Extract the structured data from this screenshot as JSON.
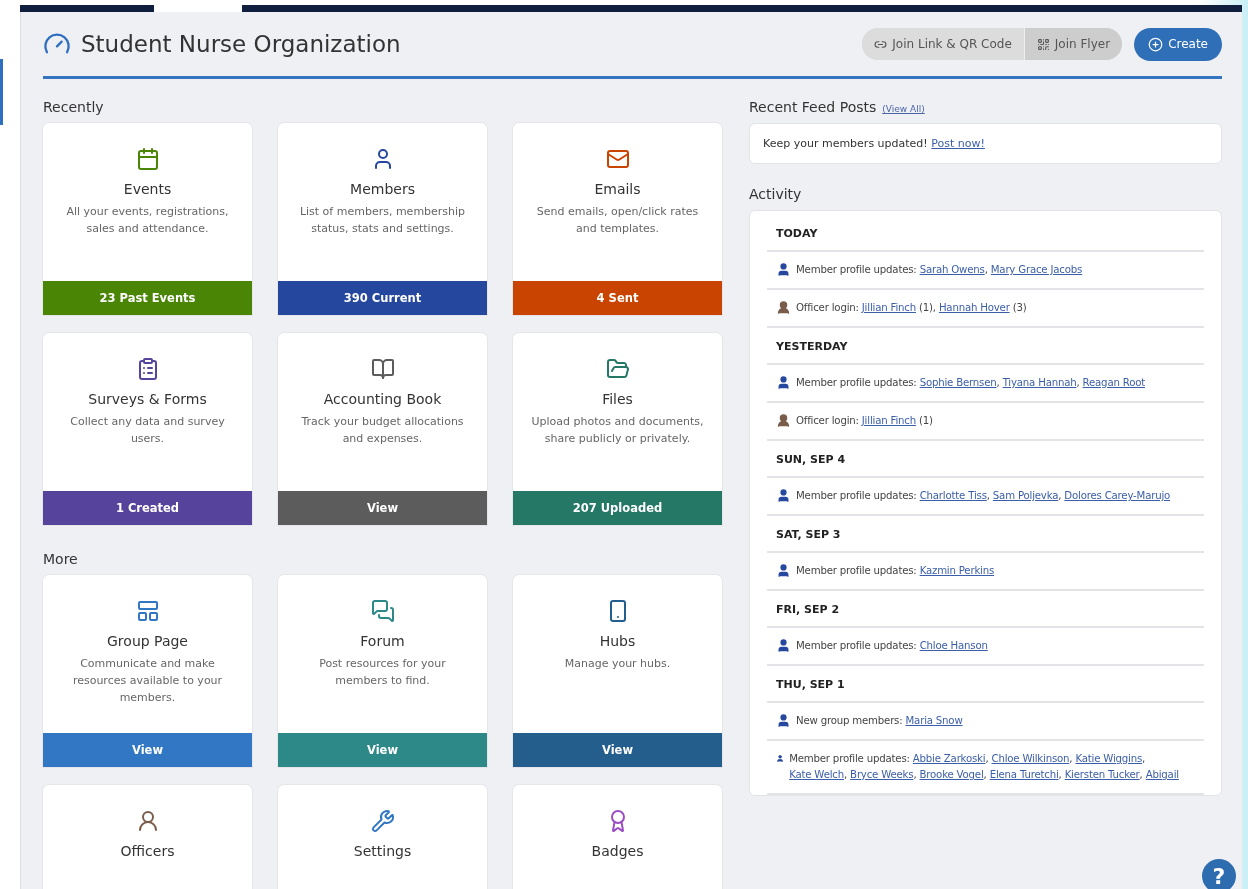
{
  "page": {
    "title": "Student Nurse Organization"
  },
  "header_buttons": [
    {
      "label": "Join Link & QR Code"
    },
    {
      "label": "Join Flyer"
    }
  ],
  "create_button": {
    "label": "Create"
  },
  "sections": [
    {
      "heading": "Recently",
      "cards": [
        {
          "title": "Events",
          "description": "All your events, registrations, sales and attendance.",
          "footer": "23 Past Events",
          "color": "#4a8506"
        },
        {
          "title": "Members",
          "description": "List of members, membership status, stats and settings.",
          "footer": "390 Current",
          "color": "#26479e"
        },
        {
          "title": "Emails",
          "description": "Send emails, open/click rates and templates.",
          "footer": "4 Sent",
          "color": "#c84400"
        },
        {
          "title": "Surveys & Forms",
          "description": "Collect any data and survey users.",
          "footer": "1 Created",
          "color": "#56449c"
        },
        {
          "title": "Accounting Book",
          "description": "Track your budget allocations and expenses.",
          "footer": "View",
          "color": "#5c5c5c"
        },
        {
          "title": "Files",
          "description": "Upload photos and documents, share publicly or privately.",
          "footer": "207 Uploaded",
          "color": "#257866"
        }
      ]
    },
    {
      "heading": "More",
      "cards": [
        {
          "title": "Group Page",
          "description": "Communicate and make resources available to your members.",
          "footer": "View",
          "color": "#3277c3"
        },
        {
          "title": "Forum",
          "description": "Post resources for your members to find.",
          "footer": "View",
          "color": "#2d8888"
        },
        {
          "title": "Hubs",
          "description": "Manage your hubs.",
          "footer": "View",
          "color": "#235e8c"
        },
        {
          "title": "Officers",
          "color": "#7a5c4a"
        },
        {
          "title": "Settings",
          "color": "#3277c3"
        },
        {
          "title": "Badges",
          "color": "#9b4cc4"
        }
      ]
    }
  ],
  "feed": {
    "heading": "Recent Feed Posts",
    "view_all": "(View All)",
    "parts": [
      {
        "kind": "text",
        "text": "Keep your members updated! "
      },
      {
        "kind": "link",
        "text": "Post now!"
      }
    ]
  },
  "activity": {
    "heading": "Activity",
    "days": [
      {
        "label": "TODAY",
        "entries": [
          {
            "kind": "member",
            "parts": [
              {
                "kind": "text",
                "text": "Member profile updates: "
              },
              {
                "kind": "link",
                "text": "Sarah Owens"
              },
              {
                "kind": "text",
                "text": ", "
              },
              {
                "kind": "link",
                "text": "Mary Grace Jacobs"
              }
            ]
          },
          {
            "kind": "officer",
            "parts": [
              {
                "kind": "text",
                "text": "Officer login: "
              },
              {
                "kind": "link",
                "text": "Jillian Finch"
              },
              {
                "kind": "text",
                "text": " (1), "
              },
              {
                "kind": "link",
                "text": "Hannah Hover"
              },
              {
                "kind": "text",
                "text": " (3)"
              }
            ]
          }
        ]
      },
      {
        "label": "YESTERDAY",
        "entries": [
          {
            "kind": "member",
            "parts": [
              {
                "kind": "text",
                "text": "Member profile updates: "
              },
              {
                "kind": "link",
                "text": "Sophie Bernsen"
              },
              {
                "kind": "text",
                "text": ", "
              },
              {
                "kind": "link",
                "text": "Tiyana Hannah"
              },
              {
                "kind": "text",
                "text": ", "
              },
              {
                "kind": "link",
                "text": "Reagan Root"
              }
            ]
          },
          {
            "kind": "officer",
            "parts": [
              {
                "kind": "text",
                "text": "Officer login: "
              },
              {
                "kind": "link",
                "text": "Jillian Finch"
              },
              {
                "kind": "text",
                "text": " (1)"
              }
            ]
          }
        ]
      },
      {
        "label": "SUN, SEP 4",
        "entries": [
          {
            "kind": "member",
            "parts": [
              {
                "kind": "text",
                "text": "Member profile updates: "
              },
              {
                "kind": "link",
                "text": "Charlotte Tiss"
              },
              {
                "kind": "text",
                "text": ", "
              },
              {
                "kind": "link",
                "text": "Sam Poljevka"
              },
              {
                "kind": "text",
                "text": ", "
              },
              {
                "kind": "link",
                "text": "Dolores Carey-Marujo"
              }
            ]
          }
        ]
      },
      {
        "label": "SAT, SEP 3",
        "entries": [
          {
            "kind": "member",
            "parts": [
              {
                "kind": "text",
                "text": "Member profile updates: "
              },
              {
                "kind": "link",
                "text": "Kazmin Perkins"
              }
            ]
          }
        ]
      },
      {
        "label": "FRI, SEP 2",
        "entries": [
          {
            "kind": "member",
            "parts": [
              {
                "kind": "text",
                "text": "Member profile updates: "
              },
              {
                "kind": "link",
                "text": "Chloe Hanson"
              }
            ]
          }
        ]
      },
      {
        "label": "THU, SEP 1",
        "entries": [
          {
            "kind": "member",
            "parts": [
              {
                "kind": "text",
                "text": "New group members: "
              },
              {
                "kind": "link",
                "text": "Maria Snow"
              }
            ]
          },
          {
            "kind": "member",
            "parts": [
              {
                "kind": "text",
                "text": "Member profile updates: "
              },
              {
                "kind": "link",
                "text": "Abbie Zarkoski"
              },
              {
                "kind": "text",
                "text": ", "
              },
              {
                "kind": "link",
                "text": "Chloe Wilkinson"
              },
              {
                "kind": "text",
                "text": ", "
              },
              {
                "kind": "link",
                "text": "Katie Wiggins"
              },
              {
                "kind": "text",
                "text": ", "
              },
              {
                "kind": "link",
                "text": "Kate Welch"
              },
              {
                "kind": "text",
                "text": ", "
              },
              {
                "kind": "link",
                "text": "Bryce Weeks"
              },
              {
                "kind": "text",
                "text": ", "
              },
              {
                "kind": "link",
                "text": "Brooke Vogel"
              },
              {
                "kind": "text",
                "text": ", "
              },
              {
                "kind": "link",
                "text": "Elena Turetchi"
              },
              {
                "kind": "text",
                "text": ", "
              },
              {
                "kind": "link",
                "text": "Kiersten Tucker"
              },
              {
                "kind": "text",
                "text": ", "
              },
              {
                "kind": "link",
                "text": "Abigail"
              }
            ]
          }
        ]
      }
    ]
  },
  "help_button": {
    "label": "?"
  }
}
